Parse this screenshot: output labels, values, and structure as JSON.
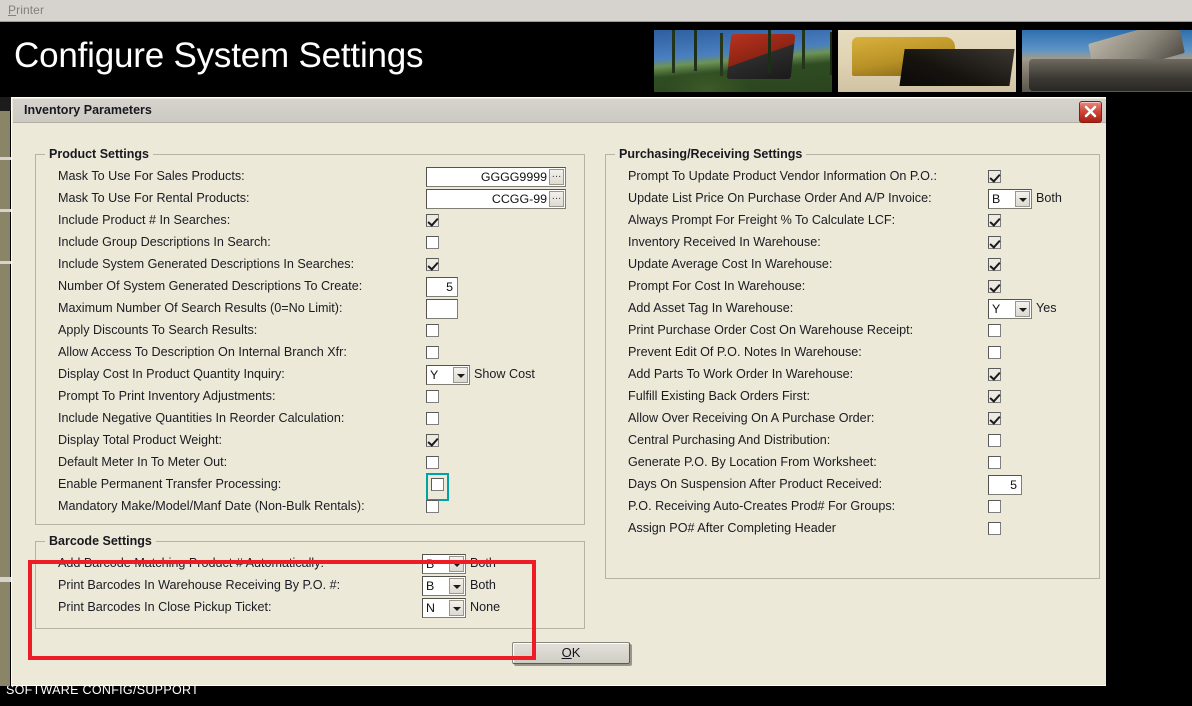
{
  "menubar": {
    "label": "Printer",
    "accel": "P"
  },
  "banner": {
    "title": "Configure System Settings"
  },
  "dialog": {
    "title": "Inventory Parameters",
    "close_tooltip": "Close"
  },
  "ok_button": {
    "label": "OK",
    "accel": "O",
    "rest": "K"
  },
  "statusbar": {
    "text": "SOFTWARE CONFIG/SUPPORT"
  },
  "colors": {
    "dialog_bg": "#ece9d8",
    "highlight_red": "#ee1c24",
    "focus_teal": "#00a2a8",
    "banner_bg": "#000000",
    "titlebar": "#d6d3ce"
  },
  "product_settings": {
    "legend": "Product Settings",
    "rows": [
      {
        "label": "Mask To Use For Sales Products:",
        "type": "text",
        "value": "GGGG9999",
        "button": "…"
      },
      {
        "label": "Mask To Use For Rental Products:",
        "type": "text",
        "value": "CCGG-99",
        "button": "…"
      },
      {
        "label": "Include Product # In Searches:",
        "type": "checkbox",
        "checked": true
      },
      {
        "label": "Include Group Descriptions In Search:",
        "type": "checkbox",
        "checked": false
      },
      {
        "label": "Include System Generated Descriptions In Searches:",
        "type": "checkbox",
        "checked": true
      },
      {
        "label": "Number Of System Generated Descriptions To Create:",
        "type": "number",
        "value": "5"
      },
      {
        "label": "Maximum Number Of Search Results (0=No Limit):",
        "type": "number",
        "value": ""
      },
      {
        "label": "Apply Discounts To Search Results:",
        "type": "checkbox",
        "checked": false
      },
      {
        "label": "Allow Access To Description On Internal Branch Xfr:",
        "type": "checkbox",
        "checked": false
      },
      {
        "label": "Display Cost In Product Quantity Inquiry:",
        "type": "combo",
        "value": "Y",
        "text": "Show Cost"
      },
      {
        "label": "Prompt To Print Inventory Adjustments:",
        "type": "checkbox",
        "checked": false
      },
      {
        "label": "Include Negative Quantities In Reorder Calculation:",
        "type": "checkbox",
        "checked": false
      },
      {
        "label": "Display Total Product Weight:",
        "type": "checkbox",
        "checked": true
      },
      {
        "label": "Default Meter In To Meter Out:",
        "type": "checkbox",
        "checked": false
      },
      {
        "label": "Enable Permanent Transfer Processing:",
        "type": "checkbox",
        "checked": false,
        "focused": true
      },
      {
        "label": "Mandatory Make/Model/Manf Date (Non-Bulk Rentals):",
        "type": "checkbox",
        "checked": false
      }
    ]
  },
  "barcode_settings": {
    "legend": "Barcode Settings",
    "rows": [
      {
        "label": "Add Barcode Matching Product # Automatically:",
        "type": "combo",
        "value": "B",
        "text": "Both"
      },
      {
        "label": "Print Barcodes In Warehouse Receiving By P.O. #:",
        "type": "combo",
        "value": "B",
        "text": "Both"
      },
      {
        "label": "Print Barcodes In Close Pickup Ticket:",
        "type": "combo",
        "value": "N",
        "text": "None"
      }
    ]
  },
  "purchasing_settings": {
    "legend": "Purchasing/Receiving Settings",
    "rows": [
      {
        "label": "Prompt To Update Product Vendor Information On P.O.:",
        "type": "checkbox",
        "checked": true
      },
      {
        "label": "Update List Price On Purchase Order And A/P Invoice:",
        "type": "combo",
        "value": "B",
        "text": "Both"
      },
      {
        "label": "Always Prompt For Freight % To Calculate LCF:",
        "type": "checkbox",
        "checked": true
      },
      {
        "label": "Inventory Received In Warehouse:",
        "type": "checkbox",
        "checked": true
      },
      {
        "label": "Update Average Cost In Warehouse:",
        "type": "checkbox",
        "checked": true
      },
      {
        "label": "Prompt For Cost In Warehouse:",
        "type": "checkbox",
        "checked": true
      },
      {
        "label": "Add Asset Tag In Warehouse:",
        "type": "combo",
        "value": "Y",
        "text": "Yes"
      },
      {
        "label": "Print Purchase Order Cost On Warehouse Receipt:",
        "type": "checkbox",
        "checked": false
      },
      {
        "label": "Prevent Edit Of P.O. Notes In Warehouse:",
        "type": "checkbox",
        "checked": false
      },
      {
        "label": "Add Parts To Work Order In Warehouse:",
        "type": "checkbox",
        "checked": true
      },
      {
        "label": "Fulfill Existing Back Orders First:",
        "type": "checkbox",
        "checked": true
      },
      {
        "label": "Allow Over Receiving On A Purchase Order:",
        "type": "checkbox",
        "checked": true
      },
      {
        "label": "Central Purchasing And Distribution:",
        "type": "checkbox",
        "checked": false
      },
      {
        "label": "Generate P.O. By Location From Worksheet:",
        "type": "checkbox",
        "checked": false
      },
      {
        "label": "Days On Suspension After Product Received:",
        "type": "number",
        "value": "5"
      },
      {
        "label": "P.O. Receiving Auto-Creates Prod# For Groups:",
        "type": "checkbox",
        "checked": false
      },
      {
        "label": "Assign PO# After Completing Header",
        "type": "checkbox",
        "checked": false
      }
    ]
  }
}
